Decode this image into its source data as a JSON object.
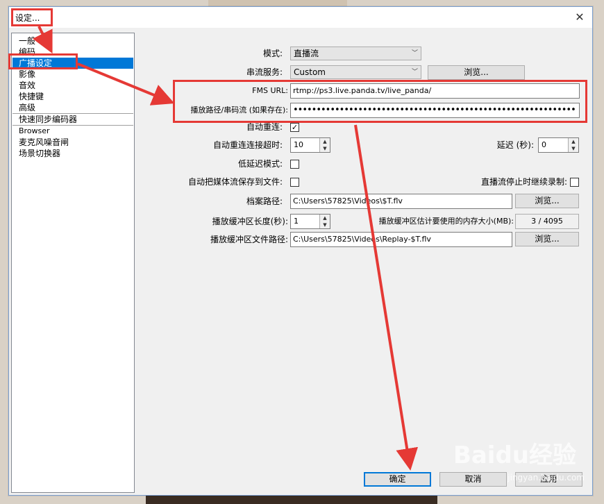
{
  "window": {
    "title": "设定...",
    "close_glyph": "✕"
  },
  "sidebar": {
    "items": [
      {
        "label": "一般"
      },
      {
        "label": "编码"
      },
      {
        "label": "广播设定",
        "selected": true
      },
      {
        "label": "影像"
      },
      {
        "label": "音效"
      },
      {
        "label": "快捷键"
      },
      {
        "label": "高级"
      },
      {
        "label": "快速同步编码器"
      },
      {
        "label": "Browser"
      },
      {
        "label": "麦克风噪音闸"
      },
      {
        "label": "场景切换器"
      }
    ]
  },
  "form": {
    "mode_label": "模式:",
    "mode_value": "直播流",
    "service_label": "串流服务:",
    "service_value": "Custom",
    "browse_label": "浏览...",
    "fms_url_label": "FMS URL:",
    "fms_url_value": "rtmp://ps3.live.panda.tv/live_panda/",
    "stream_key_label": "播放路径/串码流 (如果存在):",
    "stream_key_value": "•••••••••••••••••••••••••••••••••••••••••••••••••••••••••••••",
    "auto_reconnect_label": "自动重连:",
    "auto_reconnect_checked": "✓",
    "reconnect_timeout_label": "自动重连连接超时:",
    "reconnect_timeout_value": "10",
    "delay_label": "延迟 (秒):",
    "delay_value": "0",
    "low_latency_label": "低延迟模式:",
    "save_to_file_label": "自动把媒体流保存到文件:",
    "keep_recording_label": "直播流停止时继续录制:",
    "file_path_label": "档案路径:",
    "file_path_value": "C:\\Users\\57825\\Videos\\$T.flv",
    "file_browse_label": "浏览...",
    "buffer_length_label": "播放缓冲区长度(秒):",
    "buffer_length_value": "1",
    "buffer_memory_label": "播放缓冲区估计要使用的内存大小(MB):",
    "buffer_memory_value": "3 / 4095",
    "buffer_path_label": "播放缓冲区文件路径:",
    "buffer_path_value": "C:\\Users\\57825\\Videos\\Replay-$T.flv",
    "buffer_browse_label": "浏览..."
  },
  "buttons": {
    "ok": "确定",
    "cancel": "取消",
    "apply": "应用"
  },
  "spin_up": "▲",
  "spin_down": "▼",
  "combo_arrow": "﹀",
  "watermark": {
    "brand": "Baidu经验",
    "url": "jingyan.baidu.com"
  },
  "colors": {
    "highlight": "#e53935",
    "selection": "#0078d7"
  }
}
